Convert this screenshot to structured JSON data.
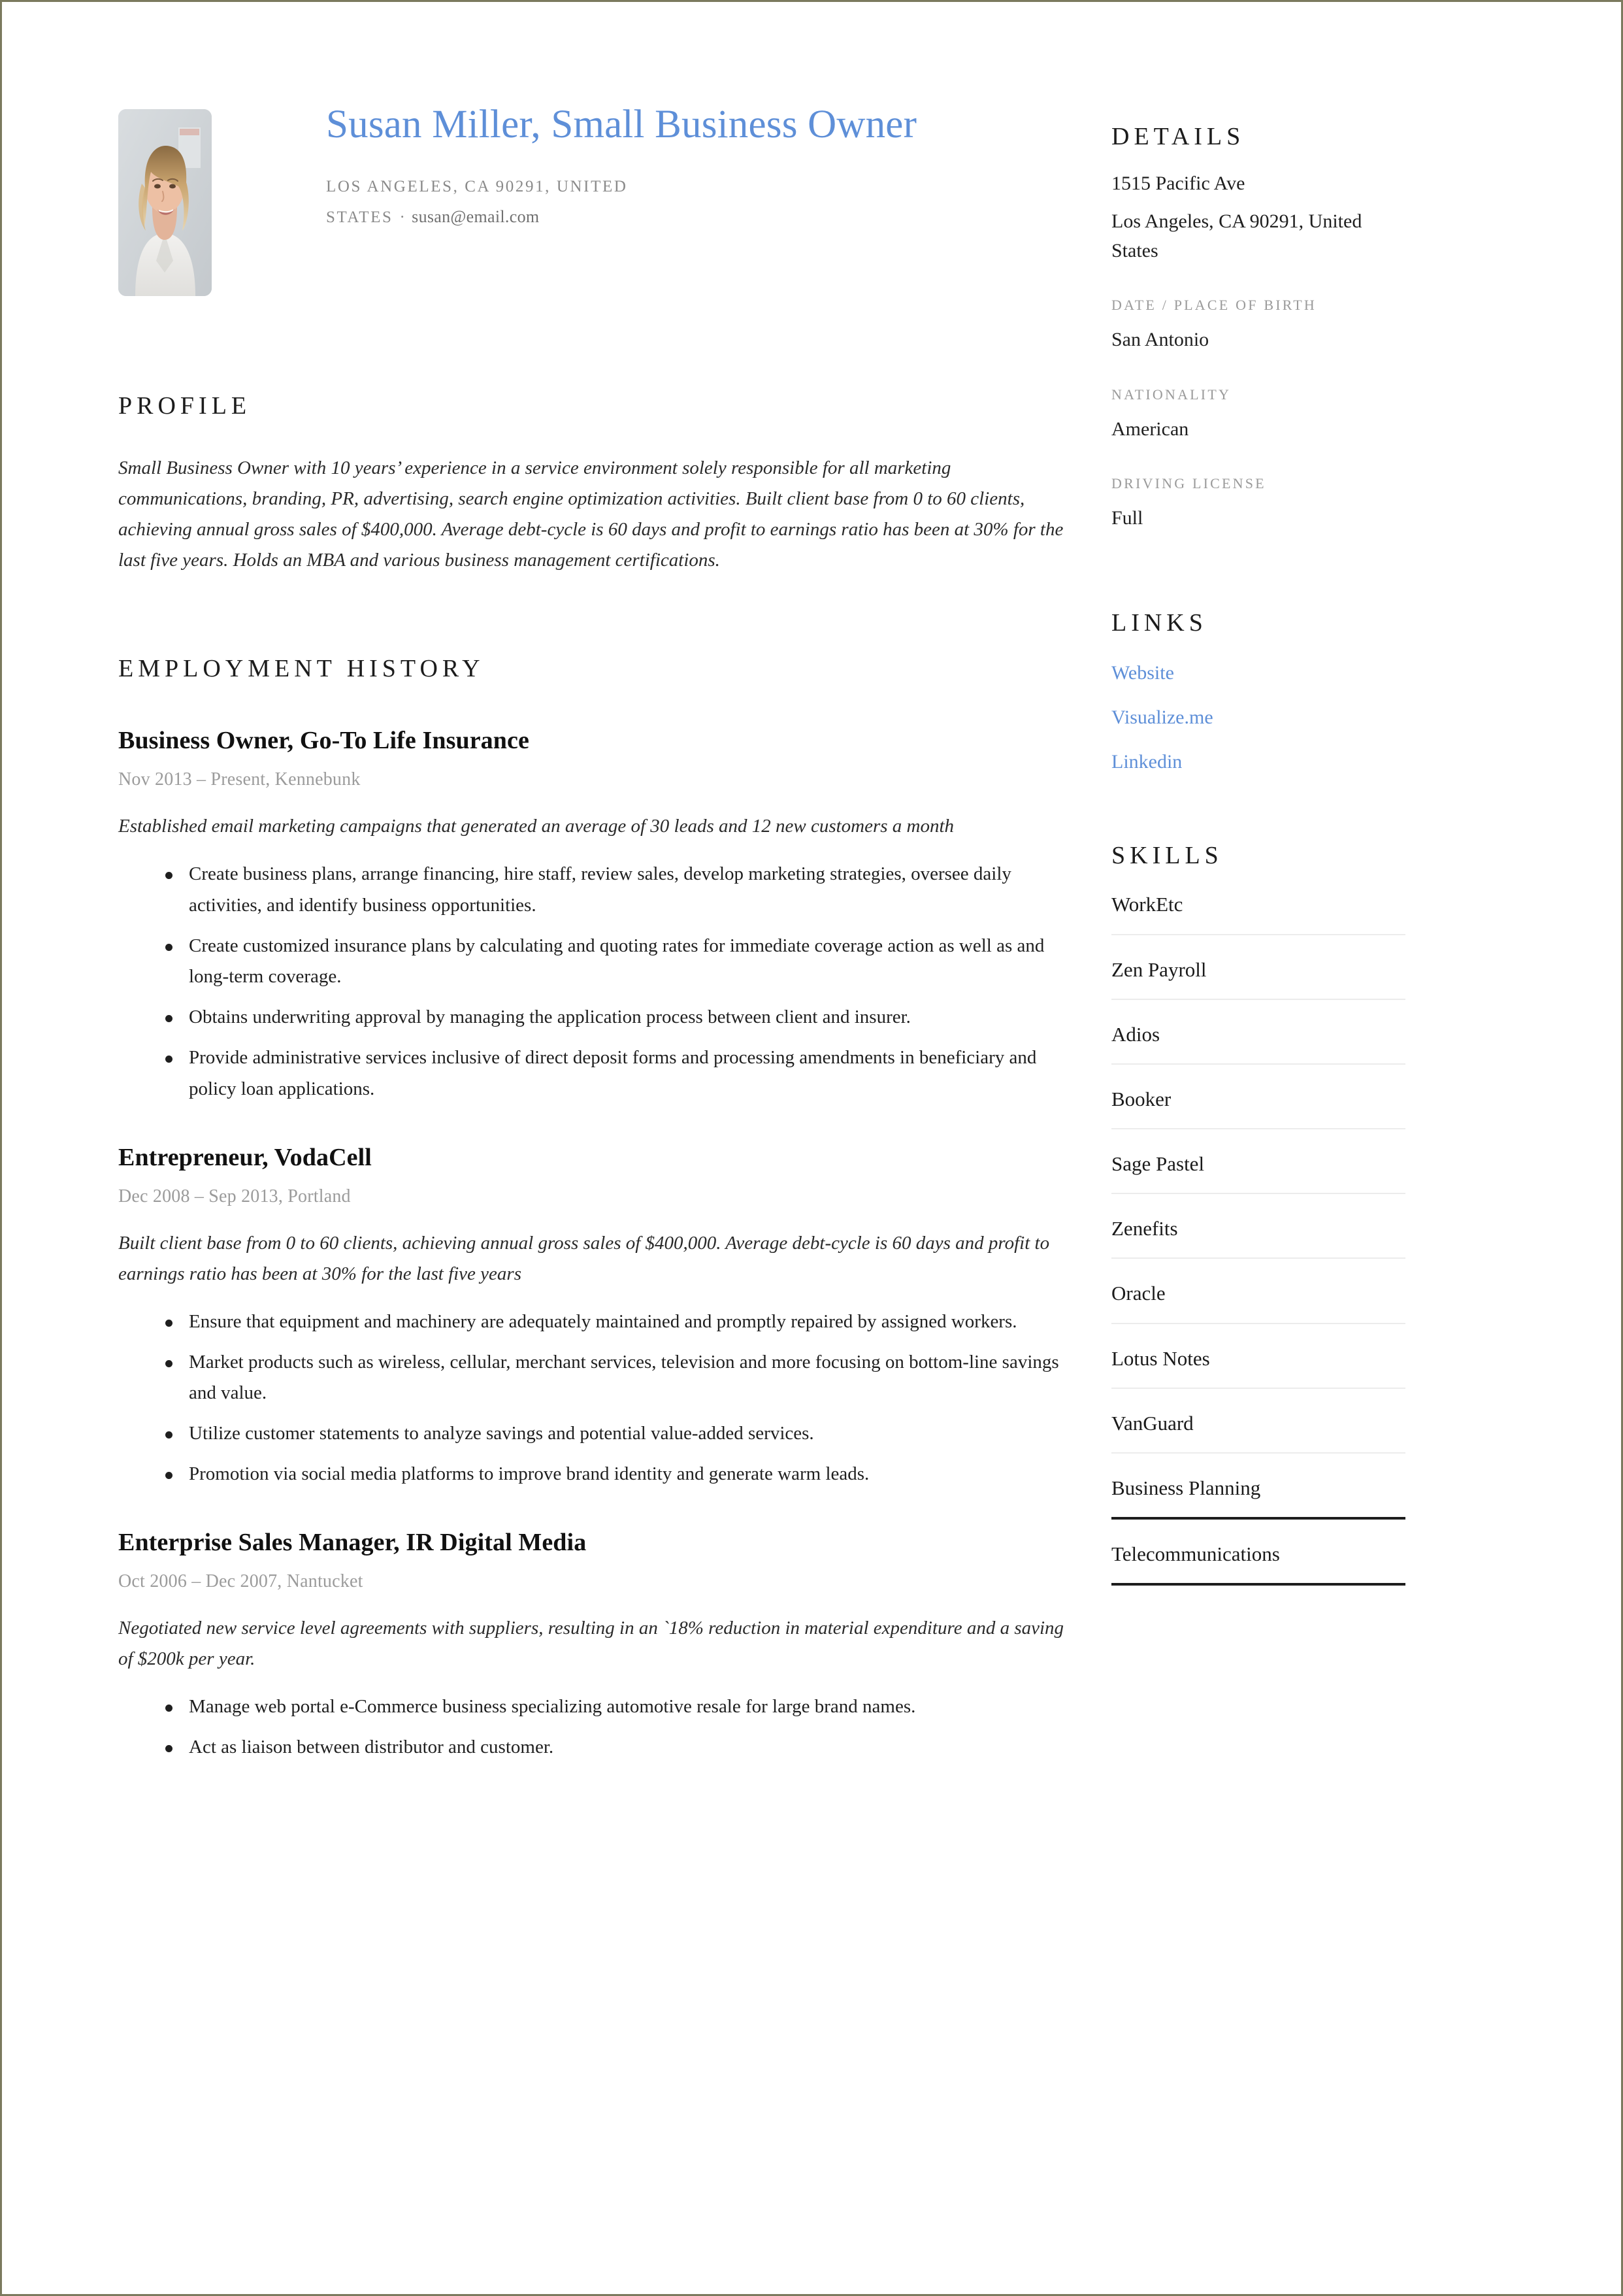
{
  "theme": {
    "accent_blue": "#5e8fd8",
    "page_border": "#7b7a5e",
    "muted_gray": "#9a9a9a",
    "rule_light": "#ececec",
    "rule_dark": "#1d1d1d"
  },
  "header": {
    "name_title": "Susan Miller, Small Business Owner",
    "location": "LOS ANGELES, CA 90291, UNITED STATES",
    "separator": "·",
    "email": "susan@email.com",
    "photo_alt": "headshot-photo"
  },
  "profile": {
    "heading": "PROFILE",
    "text": "Small Business Owner with 10 years’ experience in a service environment solely responsible for all marketing communications, branding, PR, advertising, search engine optimization activities. Built client base from 0 to 60 clients, achieving annual gross sales of $400,000. Average debt-cycle is 60 days and profit to earnings ratio has been at 30% for the last five years. Holds an MBA and various business management certifications."
  },
  "employment": {
    "heading": "EMPLOYMENT HISTORY",
    "jobs": [
      {
        "title": "Business Owner, Go-To Life Insurance",
        "meta": "Nov 2013 – Present, Kennebunk",
        "description": "Established email marketing campaigns that generated an average of 30 leads and 12 new customers a month",
        "bullets": [
          "Create business plans, arrange financing, hire staff, review sales, develop marketing strategies, oversee daily activities, and identify business opportunities.",
          "Create customized insurance plans by calculating and quoting rates for immediate coverage action as well as and long-term coverage.",
          "Obtains underwriting approval by managing the application process between client and insurer.",
          "Provide administrative services inclusive of direct deposit forms and processing amendments in beneficiary and policy loan applications."
        ]
      },
      {
        "title": "Entrepreneur, VodaCell",
        "meta": "Dec 2008 – Sep 2013, Portland",
        "description": "Built client base from 0 to 60 clients, achieving annual gross sales of $400,000. Average debt-cycle is 60 days and profit to earnings ratio has been at 30% for the last five years",
        "bullets": [
          "Ensure that equipment and machinery are adequately maintained and promptly repaired by assigned workers.",
          "Market products such as wireless, cellular, merchant services, television and more focusing on bottom-line savings and value.",
          "Utilize customer statements to analyze savings and potential value-added services.",
          "Promotion via social media platforms to improve brand identity and generate warm leads."
        ]
      },
      {
        "title": "Enterprise Sales Manager, IR Digital Media",
        "meta": "Oct 2006 – Dec 2007, Nantucket",
        "description": "Negotiated new service level agreements with suppliers, resulting in an `18% reduction in material expenditure and a saving of $200k per year.",
        "bullets": [
          "Manage web portal e-Commerce business specializing automotive resale for large brand names.",
          "Act as liaison between distributor and customer."
        ]
      }
    ]
  },
  "details": {
    "heading": "DETAILS",
    "address_line1": "1515 Pacific Ave",
    "address_line2": "Los Angeles, CA 90291, United States",
    "dob_label": "DATE / PLACE OF BIRTH",
    "dob_value": "San Antonio",
    "nationality_label": "NATIONALITY",
    "nationality_value": "American",
    "license_label": "DRIVING LICENSE",
    "license_value": "Full"
  },
  "links": {
    "heading": "LINKS",
    "items": [
      {
        "label": "Website"
      },
      {
        "label": "Visualize.me"
      },
      {
        "label": "Linkedin"
      }
    ]
  },
  "skills": {
    "heading": "SKILLS",
    "items": [
      {
        "label": "WorkEtc",
        "rule": "light"
      },
      {
        "label": "Zen Payroll",
        "rule": "light"
      },
      {
        "label": "Adios",
        "rule": "light"
      },
      {
        "label": "Booker",
        "rule": "light"
      },
      {
        "label": "Sage Pastel",
        "rule": "light"
      },
      {
        "label": "Zenefits",
        "rule": "light"
      },
      {
        "label": "Oracle",
        "rule": "light"
      },
      {
        "label": "Lotus Notes",
        "rule": "light"
      },
      {
        "label": "VanGuard",
        "rule": "light"
      },
      {
        "label": "Business Planning",
        "rule": "strong"
      },
      {
        "label": "Telecommunications",
        "rule": "strong"
      }
    ]
  }
}
